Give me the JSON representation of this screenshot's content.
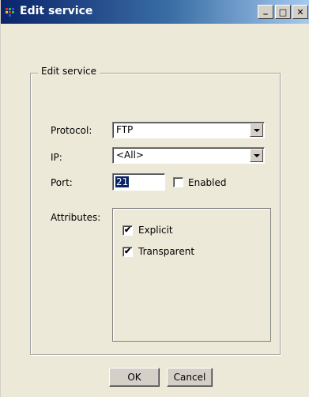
{
  "window": {
    "title": "Edit service",
    "minimize_glyph": "_",
    "maximize_glyph": "□",
    "close_glyph": "✕"
  },
  "group": {
    "legend": "Edit service"
  },
  "protocol": {
    "label": "Protocol:",
    "value": "FTP"
  },
  "ip": {
    "label": "IP:",
    "value": "<All>"
  },
  "port": {
    "label": "Port:",
    "value": "21",
    "enabled_label": "Enabled",
    "enabled_checked": false
  },
  "attributes": {
    "label": "Attributes:",
    "items": [
      {
        "label": "Explicit",
        "checked": true
      },
      {
        "label": "Transparent",
        "checked": true
      }
    ]
  },
  "buttons": {
    "ok": "OK",
    "cancel": "Cancel"
  },
  "colors": {
    "titlebar_start": "#0a246a",
    "titlebar_end": "#a6caf0",
    "dialog_bg": "#ece9d8"
  }
}
